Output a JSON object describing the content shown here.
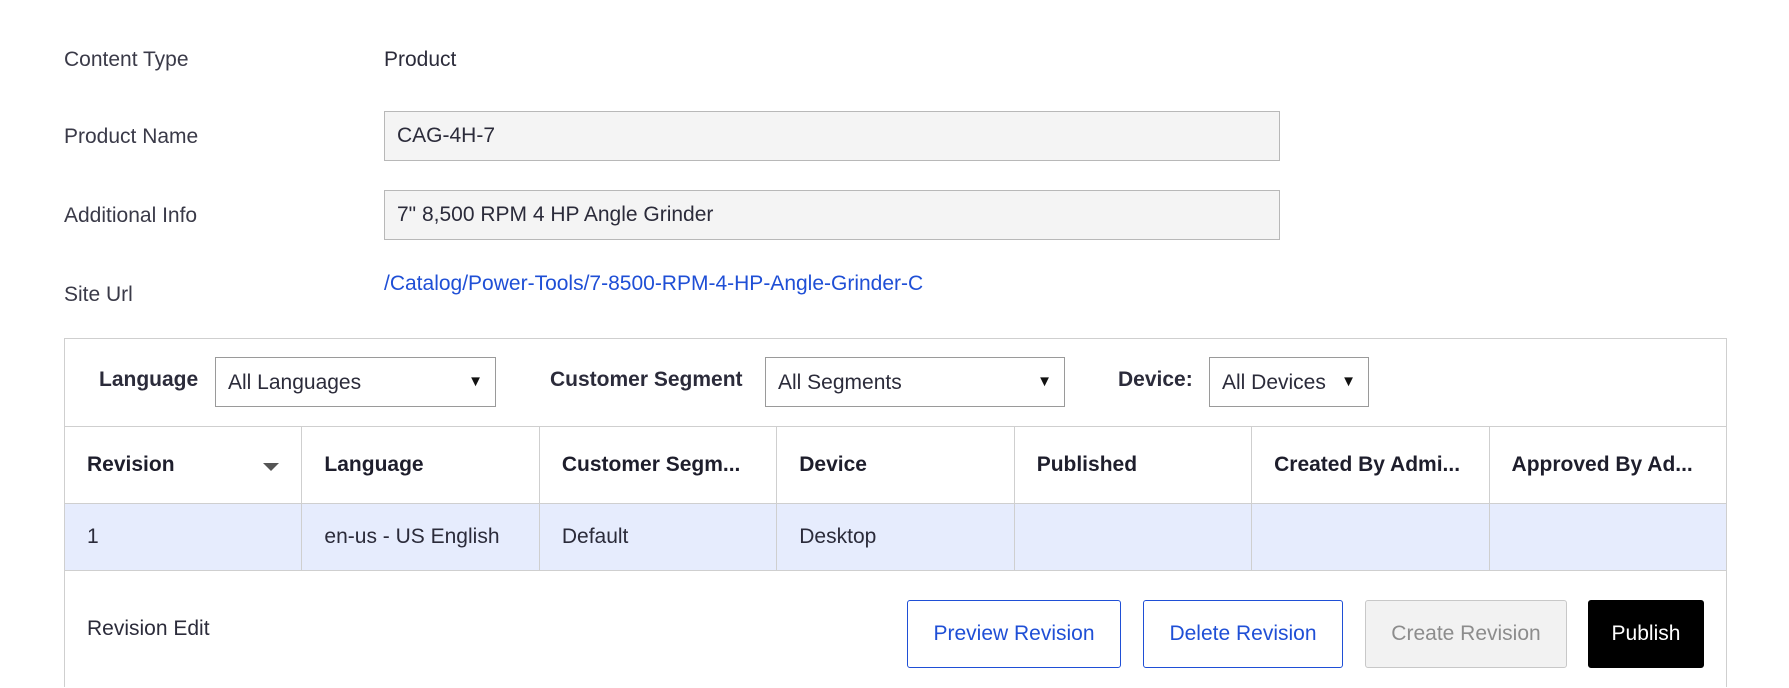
{
  "fields": {
    "content_type": {
      "label": "Content Type",
      "value": "Product"
    },
    "product_name": {
      "label": "Product Name",
      "value": "CAG-4H-7"
    },
    "additional_info": {
      "label": "Additional Info",
      "value": "7\" 8,500 RPM 4 HP Angle Grinder"
    },
    "site_url": {
      "label": "Site Url",
      "value": "/Catalog/Power-Tools/7-8500-RPM-4-HP-Angle-Grinder-C"
    }
  },
  "filters": {
    "language": {
      "label": "Language",
      "selected": "All Languages"
    },
    "segment": {
      "label": "Customer Segment",
      "selected": "All Segments"
    },
    "device": {
      "label": "Device:",
      "selected": "All Devices"
    }
  },
  "table": {
    "columns": [
      "Revision",
      "Language",
      "Customer Segm...",
      "Device",
      "Published",
      "Created By Admi...",
      "Approved By Ad..."
    ],
    "rows": [
      [
        "1",
        "en-us - US English",
        "Default",
        "Desktop",
        "",
        "",
        ""
      ]
    ]
  },
  "footer": {
    "title": "Revision Edit",
    "preview_label": "Preview Revision",
    "delete_label": "Delete Revision",
    "create_label": "Create Revision",
    "publish_label": "Publish"
  },
  "colors": {
    "link": "#1f4fd6",
    "row_highlight": "#e6ecfd",
    "primary_button": "#000000"
  }
}
